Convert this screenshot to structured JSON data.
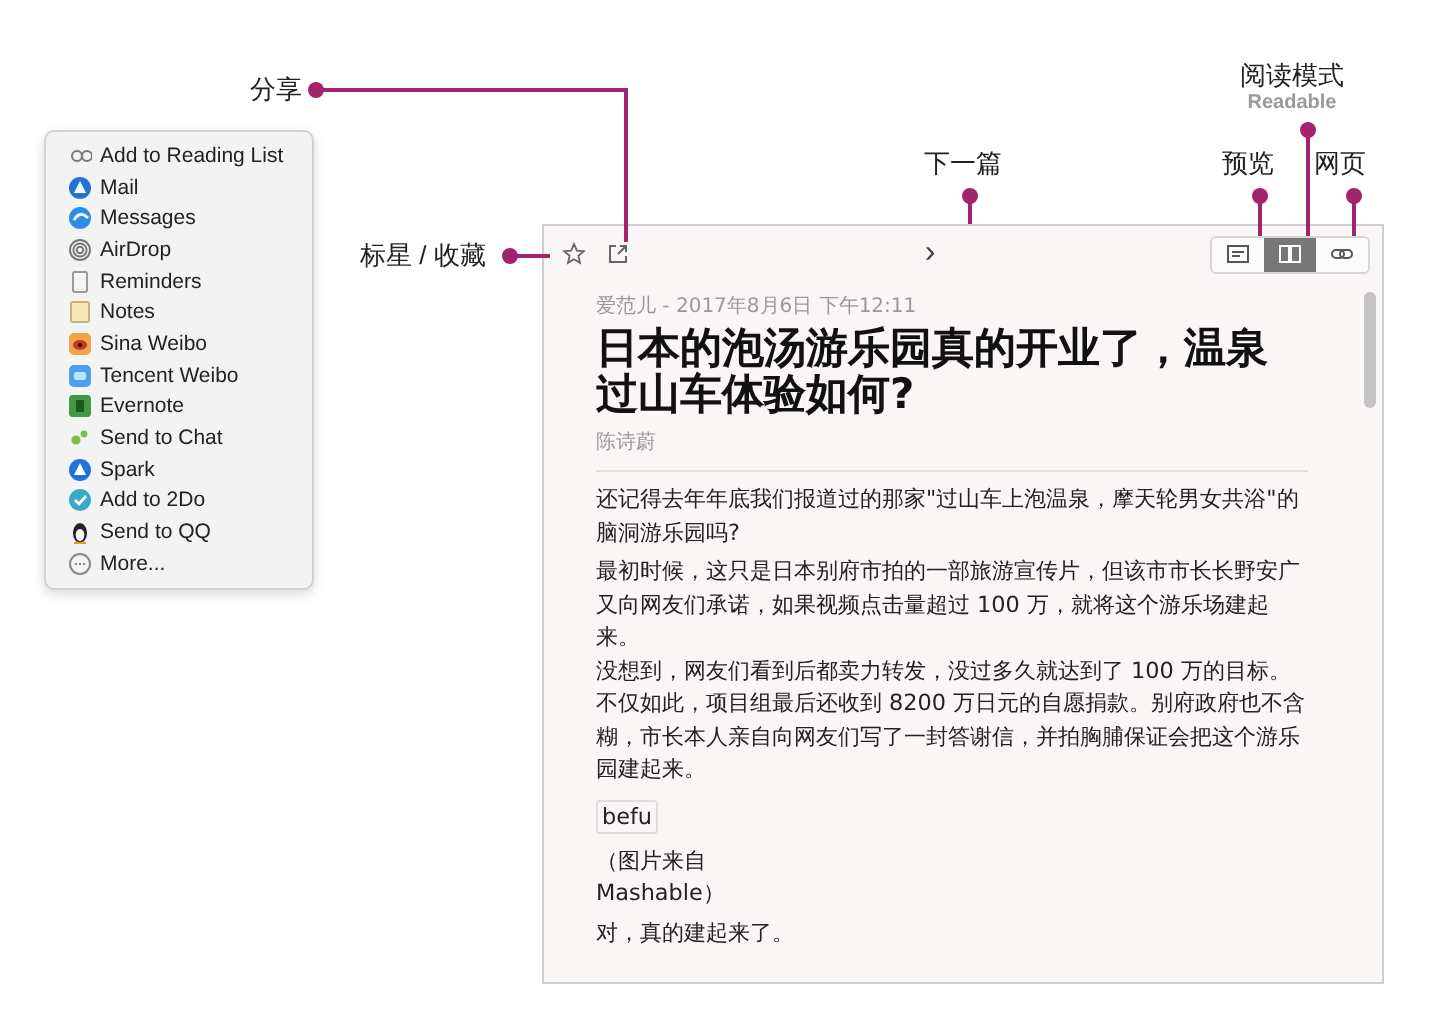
{
  "callouts": [
    {
      "label": "分享"
    },
    {
      "label": "标星 / 收藏"
    },
    {
      "label": "下一篇"
    },
    {
      "label": "预览"
    },
    {
      "label": "阅读模式",
      "sublabel": "Readable"
    },
    {
      "label": "网页"
    }
  ],
  "share_menu": {
    "items": [
      {
        "label": "Add to Reading List"
      },
      {
        "label": "Mail"
      },
      {
        "label": "Messages"
      },
      {
        "label": "AirDrop"
      },
      {
        "label": "Reminders"
      },
      {
        "label": "Notes"
      },
      {
        "label": "Sina Weibo"
      },
      {
        "label": "Tencent Weibo"
      },
      {
        "label": "Evernote"
      },
      {
        "label": "Send to Chat"
      },
      {
        "label": "Spark"
      },
      {
        "label": "Add to 2Do"
      },
      {
        "label": "Send to QQ"
      },
      {
        "label": "More..."
      }
    ]
  },
  "reader": {
    "toolbar": {
      "next_icon": "›",
      "view_modes": [
        {
          "selected": false
        },
        {
          "selected": true
        },
        {
          "selected": false
        }
      ]
    },
    "article": {
      "meta": "爱范儿 - 2017年8月6日 下午12:11",
      "title": "日本的泡汤游乐园真的开业了，温泉过山车体验如何?",
      "author": "陈诗蔚",
      "blocks": [
        {
          "kind": "paragraph",
          "text": "还记得去年年底我们报道过的那家\"过山车上泡温泉，摩天轮男女共浴\"的脑洞游乐园吗?"
        },
        {
          "kind": "paragraph",
          "text": "最初时候，这只是日本别府市拍的一部旅游宣传片，但该市市长长野安广又向网友们承诺，如果视频点击量超过 100 万，就将这个游乐场建起来。"
        },
        {
          "kind": "line",
          "text": "没想到，网友们看到后都卖力转发，没过多久就达到了 100 万的目标。不仅如此，项目组最后还收到 8200 万日元的自愿捐款。别府政府也不含糊，市长本人亲自向网友们写了一封答谢信，并拍胸脯保证会把这个游乐园建起来。"
        },
        {
          "kind": "image_alt",
          "text": "befu"
        },
        {
          "kind": "caption",
          "text": "（图片来自\nMashable）"
        },
        {
          "kind": "paragraph",
          "text": "对，真的建起来了。"
        }
      ]
    }
  }
}
